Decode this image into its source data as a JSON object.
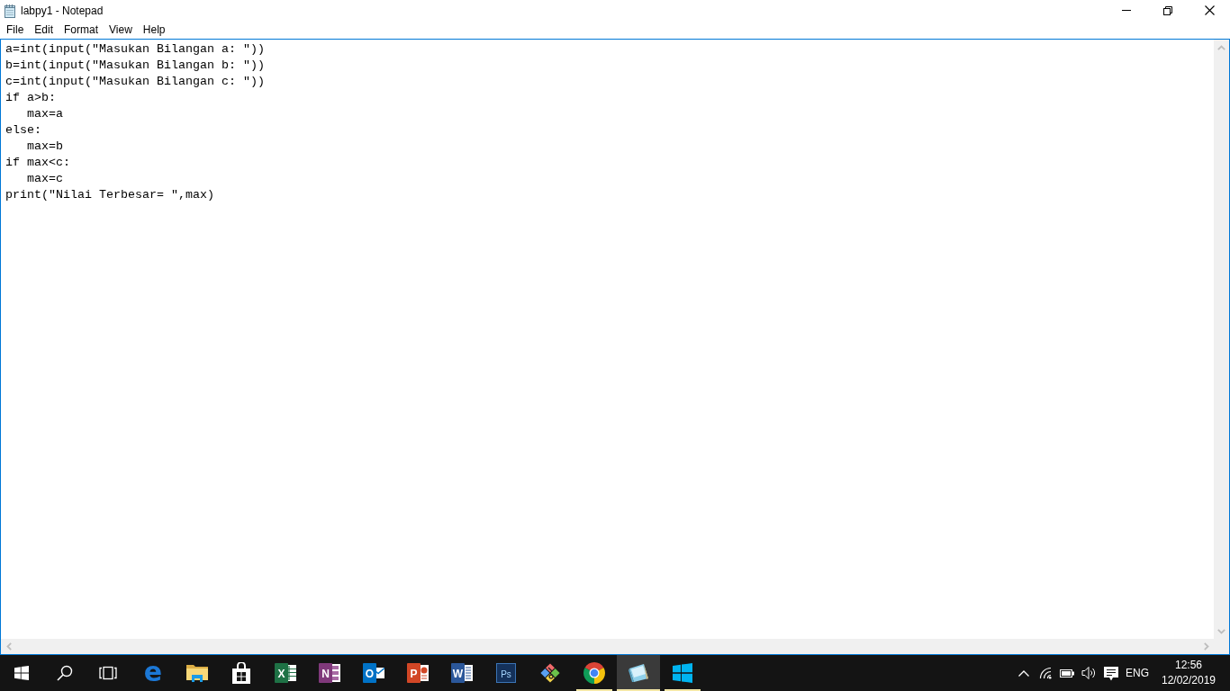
{
  "window": {
    "title": "labpy1 - Notepad"
  },
  "menu": [
    "File",
    "Edit",
    "Format",
    "View",
    "Help"
  ],
  "editor": {
    "lines": [
      "a=int(input(\"Masukan Bilangan a: \"))",
      "b=int(input(\"Masukan Bilangan b: \"))",
      "c=int(input(\"Masukan Bilangan c: \"))",
      "if a>b:",
      "   max=a",
      "else:",
      "   max=b",
      "if max<c:",
      "   max=c",
      "print(\"Nilai Terbesar= \",max)"
    ]
  },
  "taskbar": {
    "apps": [
      {
        "kind": "e-logo",
        "glyph": "e",
        "running": false,
        "selected": false
      },
      {
        "kind": "folder",
        "running": false,
        "selected": false
      },
      {
        "kind": "bag",
        "running": false,
        "selected": false
      },
      {
        "kind": "sheet",
        "glyph": "X",
        "running": false,
        "selected": false
      },
      {
        "kind": "notebook",
        "glyph": "N",
        "running": false,
        "selected": false
      },
      {
        "kind": "mail",
        "glyph": "O",
        "running": false,
        "selected": false
      },
      {
        "kind": "slides",
        "glyph": "P",
        "running": false,
        "selected": false
      },
      {
        "kind": "document",
        "glyph": "W",
        "running": false,
        "selected": false
      },
      {
        "kind": "ps-tile",
        "glyph": "Ps",
        "running": false,
        "selected": false
      },
      {
        "kind": "diamond",
        "running": false,
        "selected": false
      },
      {
        "kind": "ball",
        "running": true,
        "selected": false
      },
      {
        "kind": "notepad",
        "running": true,
        "selected": true
      },
      {
        "kind": "panes",
        "running": true,
        "selected": false
      }
    ],
    "tray": {
      "language": "ENG",
      "time": "12:56",
      "date": "12/02/2019"
    }
  }
}
